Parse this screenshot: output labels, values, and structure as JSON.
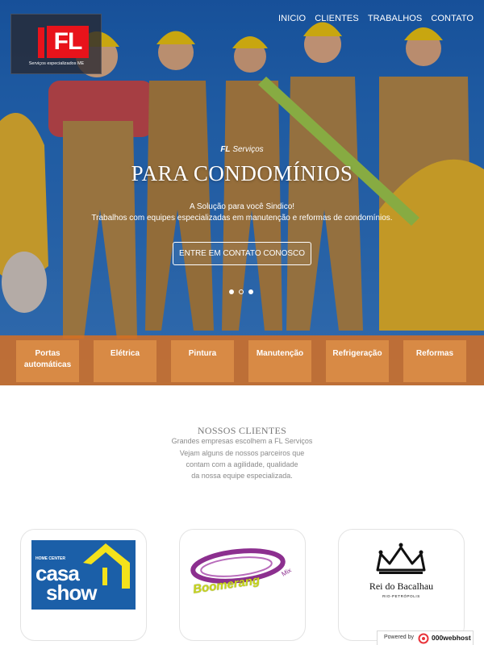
{
  "brand": {
    "mark": "FL",
    "tagline": "Serviços especializados ME"
  },
  "nav": {
    "items": [
      "INICIO",
      "CLIENTES",
      "TRABALHOS",
      "CONTATO"
    ]
  },
  "hero": {
    "kicker_strong": "FL",
    "kicker_rest": " Serviços",
    "title": "PARA CONDOMÍNIOS",
    "line1": "A Solução para você Sindico!",
    "line2": "Trabalhos com equipes especializadas em manutenção e reformas de condomínios.",
    "cta": "ENTRE EM CONTATO CONOSCO",
    "slides": {
      "count": 3,
      "active": 0
    }
  },
  "services": [
    "Portas automáticas",
    "Elétrica",
    "Pintura",
    "Manutenção",
    "Refrigeração",
    "Reformas"
  ],
  "clients": {
    "title": "NOSSOS CLIENTES",
    "lines": [
      "Grandes empresas escolhem a FL Serviços",
      "Vejam alguns de nossos parceiros que",
      "contam com a agilidade, qualidade",
      "da nossa equipe especializada."
    ],
    "logos": {
      "casa": {
        "top": "HOME CENTER",
        "word1": "casa",
        "word2": "show"
      },
      "boomerang": {
        "word": "Boomerang"
      },
      "rei": {
        "name": "Rei do Bacalhau",
        "sub": "RIO-PETRÓPOLIS"
      }
    }
  },
  "badge": {
    "prefix": "Powered by",
    "brand": "000webhost"
  },
  "colors": {
    "accent_orange": "#d88a45",
    "hero_blue": "#2467b3",
    "brand_red": "#e8131b"
  }
}
